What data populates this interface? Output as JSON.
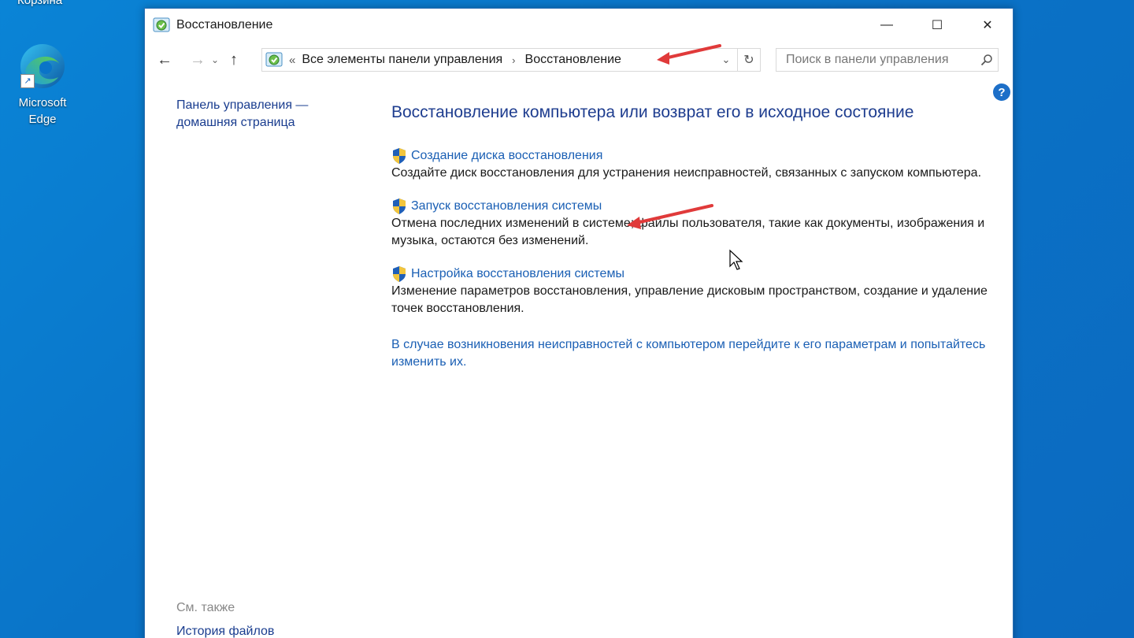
{
  "desktop": {
    "top_label": "Корзина",
    "edge_label": "Microsoft Edge"
  },
  "window": {
    "title": "Восстановление",
    "controls": {
      "minimize": "—",
      "maximize": "☐",
      "close": "✕"
    }
  },
  "nav": {
    "back": "←",
    "forward": "→",
    "recent": "⌄",
    "up": "↑",
    "breadcrumb": {
      "chevrons": "«",
      "segment1": "Все элементы панели управления",
      "separator": "›",
      "segment2": "Восстановление"
    },
    "dropdown": "⌄",
    "refresh": "↻",
    "search_placeholder": "Поиск в панели управления",
    "search_glyph": "⚲"
  },
  "help_glyph": "?",
  "sidebar": {
    "home_link": "Панель управления — домашняя страница",
    "see_also": "См. также",
    "history_link": "История файлов"
  },
  "main": {
    "title": "Восстановление компьютера или возврат его в исходное состояние",
    "tasks": [
      {
        "link": "Создание диска восстановления",
        "desc": "Создайте диск восстановления для устранения неисправностей, связанных с запуском компьютера."
      },
      {
        "link": "Запуск восстановления системы",
        "desc": "Отмена последних изменений в системе; файлы пользователя, такие как документы, изображения и музыка, остаются без изменений."
      },
      {
        "link": "Настройка восстановления системы",
        "desc": "Изменение параметров восстановления, управление дисковым пространством, создание и удаление точек восстановления."
      }
    ],
    "trouble_link": "В случае возникновения неисправностей с компьютером перейдите к его параметрам и попытайтесь изменить их."
  },
  "colors": {
    "desktop": "#0a74c8",
    "link": "#1a5fb4",
    "title": "#1e3d8f",
    "annotation_arrow": "#e03a3a"
  }
}
